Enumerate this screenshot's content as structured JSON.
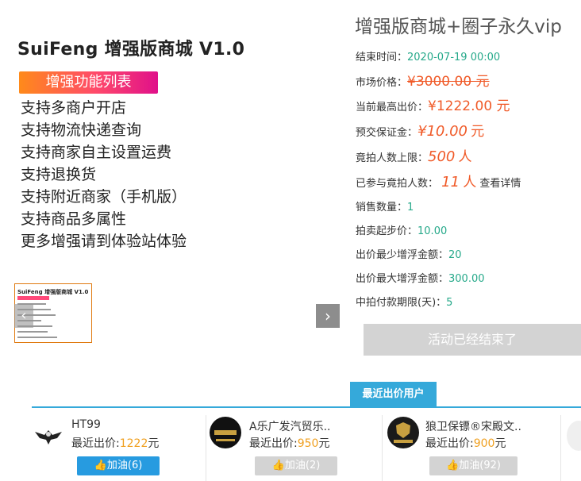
{
  "promo": {
    "title": "SuiFeng 增强版商城 V1.0",
    "badge": "增强功能列表",
    "features": [
      "支持多商户开店",
      "支持物流快递查询",
      "支持商家自主设置运费",
      "支持退换货",
      "支持附近商家（手机版）",
      "支持商品多属性",
      "更多增强请到体验站体验"
    ]
  },
  "product": {
    "title": "增强版商城+圈子永久vip",
    "end_time_label": "结束时间：",
    "end_time": "2020-07-19 00:00",
    "market_price_label": "市场价格：",
    "market_price": "¥3000.00 元",
    "highest_bid_label": "当前最高出价：",
    "highest_bid": "¥1222.00 元",
    "deposit_label": "预交保证金：",
    "deposit_value": "¥10.00",
    "deposit_unit": "元",
    "max_bidders_label": "竟拍人数上限：",
    "max_bidders_value": "500",
    "max_bidders_unit": "人",
    "joined_label": "已参与竟拍人数：",
    "joined_value": "11",
    "joined_unit": "人",
    "view_details": "查看详情",
    "sales_label": "销售数量：",
    "sales": "1",
    "start_price_label": "拍卖起步价：",
    "start_price": "10.00",
    "min_increment_label": "出价最少增浮金额：",
    "min_increment": "20",
    "max_increment_label": "出价最大增浮金额：",
    "max_increment": "300.00",
    "pay_period_label": "中拍付款期限(天)：",
    "pay_period": "5",
    "ended_button": "活动已经结束了"
  },
  "recent": {
    "tab_label": "最近出价用户",
    "bid_prefix": "最近出价:",
    "bid_suffix": "元",
    "bidders": [
      {
        "name": "HT99",
        "amount": "1222",
        "likes": "加油(6)"
      },
      {
        "name": "A乐广发汽贸乐..",
        "amount": "950",
        "likes": "加油(2)"
      },
      {
        "name": "狼卫保镖®宋殿文..",
        "amount": "900",
        "likes": "加油(92)"
      }
    ]
  },
  "thumbnail": {
    "title": "SuiFeng 增强版商城 V1.0"
  },
  "colors": {
    "accent_blue": "#35a9da",
    "price_orange": "#f05a28",
    "value_green": "#26a98a"
  }
}
